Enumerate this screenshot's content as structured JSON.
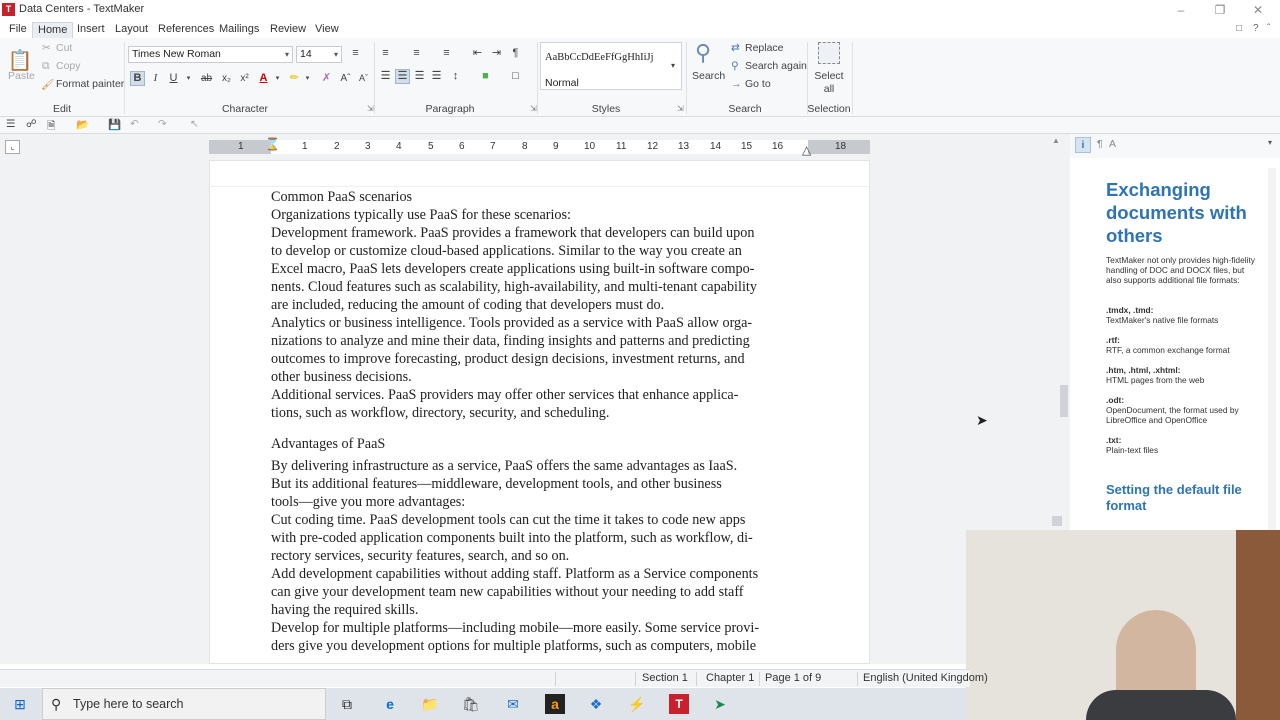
{
  "window": {
    "title": "Data Centers - TextMaker",
    "app_icon_letter": "T"
  },
  "menu": [
    "File",
    "Home",
    "Insert",
    "Layout",
    "References",
    "Mailings",
    "Review",
    "View"
  ],
  "ribbon": {
    "edit": {
      "paste": "Paste",
      "cut": "Cut",
      "copy": "Copy",
      "format_painter": "Format painter",
      "label": "Edit"
    },
    "character": {
      "font": "Times New Roman",
      "size": "14",
      "bold": "B",
      "italic": "I",
      "underline": "U",
      "label": "Character"
    },
    "paragraph": {
      "label": "Paragraph"
    },
    "styles": {
      "preview": "AaBbCcDdEeFfGgHhIiJj",
      "current": "Normal",
      "label": "Styles"
    },
    "search": {
      "search": "Search",
      "replace": "Replace",
      "search_again": "Search again",
      "go_to": "Go to",
      "label": "Search"
    },
    "selection": {
      "select_all": "Select all",
      "label": "Selection"
    }
  },
  "ruler_numbers": [
    "1",
    "1",
    "2",
    "3",
    "4",
    "5",
    "6",
    "7",
    "8",
    "9",
    "10",
    "11",
    "12",
    "13",
    "14",
    "15",
    "16",
    "18"
  ],
  "document": {
    "heading1": "Common PaaS scenarios",
    "lines1": [
      "Organizations typically use PaaS for these scenarios:",
      "Development framework. PaaS provides a framework that developers can build upon",
      "to develop or customize cloud-based applications. Similar to the way you create an",
      "Excel macro, PaaS lets developers create applications using built-in software compo-",
      "nents. Cloud features such as scalability, high-availability, and multi-tenant capability",
      "are included, reducing the amount of coding that developers must do.",
      "Analytics or business intelligence. Tools provided as a service with PaaS allow orga-",
      "nizations to analyze and mine their data, finding insights and patterns and predicting",
      "outcomes to improve forecasting, product design decisions, investment returns, and",
      "other business decisions.",
      "Additional services. PaaS providers may offer other services that enhance applica-",
      "tions, such as workflow, directory, security, and scheduling."
    ],
    "heading2": "Advantages of PaaS",
    "lines2": [
      "By delivering infrastructure as a service, PaaS offers the same advantages as IaaS.",
      "But its additional features—middleware, development tools, and other business",
      "tools—give you more advantages:",
      "Cut coding time. PaaS development tools can cut the time it takes to code new apps",
      "with pre-coded application components built into the platform, such as workflow, di-",
      "rectory services, security features, search, and so on.",
      "Add development capabilities without adding staff. Platform as a Service components",
      "can give your development team new capabilities without your needing to add staff",
      "having the required skills.",
      "Develop for multiple platforms—including mobile—more easily. Some service provi-",
      "ders give you development options for multiple platforms, such as computers, mobile"
    ]
  },
  "sidebar": {
    "title": "Exchanging documents with others",
    "intro": "TextMaker not only provides high-fidelity handling of DOC and DOCX files, but also supports additional file formats:",
    "formats": [
      {
        "ext": ".tmdx, .tmd:",
        "desc": "TextMaker's native file formats"
      },
      {
        "ext": ".rtf:",
        "desc": "RTF, a common exchange format"
      },
      {
        "ext": ".htm, .html, .xhtml:",
        "desc": "HTML pages from the web"
      },
      {
        "ext": ".odt:",
        "desc": "OpenDocument, the format used by LibreOffice and OpenOffice"
      },
      {
        "ext": ".txt:",
        "desc": "Plain-text files"
      }
    ],
    "subtitle": "Setting the default file format"
  },
  "status": {
    "section": "Section 1",
    "chapter": "Chapter 1",
    "page": "Page 1 of 9",
    "language": "English (United Kingdom)"
  },
  "taskbar": {
    "search_placeholder": "Type here to search"
  }
}
